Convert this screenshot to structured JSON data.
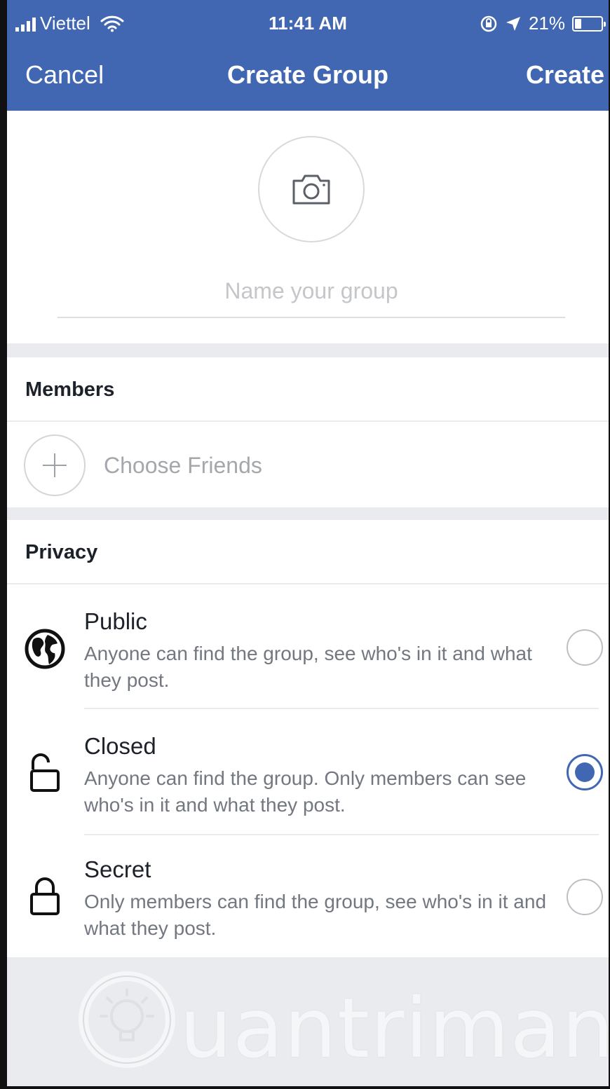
{
  "status_bar": {
    "carrier": "Viettel",
    "time": "11:41 AM",
    "battery": "21%",
    "battery_level": 0.21
  },
  "nav": {
    "cancel_label": "Cancel",
    "title": "Create Group",
    "create_label": "Create",
    "bar_color": "#4267b2"
  },
  "group": {
    "photo_icon": "camera-icon",
    "name_placeholder": "Name your group",
    "name_value": ""
  },
  "members": {
    "title": "Members",
    "choose_label": "Choose Friends"
  },
  "privacy": {
    "title": "Privacy",
    "options": [
      {
        "icon": "globe-icon",
        "title": "Public",
        "description": "Anyone can find the group, see who's in it and what they post.",
        "selected": false
      },
      {
        "icon": "unlocked-padlock-icon",
        "title": "Closed",
        "description": "Anyone can find the group. Only members can see who's in it and what they post.",
        "selected": true
      },
      {
        "icon": "locked-padlock-icon",
        "title": "Secret",
        "description": "Only members can find the group, see who's in it and what they post.",
        "selected": false
      }
    ]
  },
  "watermark": {
    "text": "uantrimang"
  }
}
